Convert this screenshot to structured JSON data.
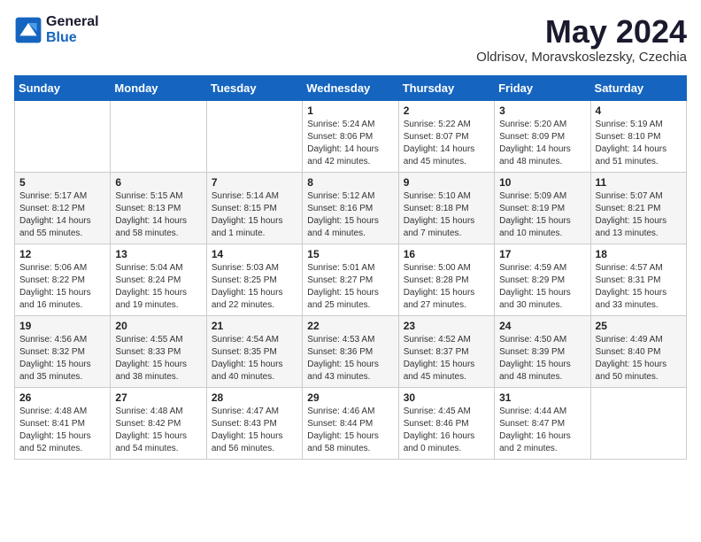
{
  "header": {
    "logo_general": "General",
    "logo_blue": "Blue",
    "month_year": "May 2024",
    "location": "Oldrisov, Moravskoslezsky, Czechia"
  },
  "weekdays": [
    "Sunday",
    "Monday",
    "Tuesday",
    "Wednesday",
    "Thursday",
    "Friday",
    "Saturday"
  ],
  "weeks": [
    [
      {
        "day": "",
        "sunrise": "",
        "sunset": "",
        "daylight": ""
      },
      {
        "day": "",
        "sunrise": "",
        "sunset": "",
        "daylight": ""
      },
      {
        "day": "",
        "sunrise": "",
        "sunset": "",
        "daylight": ""
      },
      {
        "day": "1",
        "sunrise": "Sunrise: 5:24 AM",
        "sunset": "Sunset: 8:06 PM",
        "daylight": "Daylight: 14 hours and 42 minutes."
      },
      {
        "day": "2",
        "sunrise": "Sunrise: 5:22 AM",
        "sunset": "Sunset: 8:07 PM",
        "daylight": "Daylight: 14 hours and 45 minutes."
      },
      {
        "day": "3",
        "sunrise": "Sunrise: 5:20 AM",
        "sunset": "Sunset: 8:09 PM",
        "daylight": "Daylight: 14 hours and 48 minutes."
      },
      {
        "day": "4",
        "sunrise": "Sunrise: 5:19 AM",
        "sunset": "Sunset: 8:10 PM",
        "daylight": "Daylight: 14 hours and 51 minutes."
      }
    ],
    [
      {
        "day": "5",
        "sunrise": "Sunrise: 5:17 AM",
        "sunset": "Sunset: 8:12 PM",
        "daylight": "Daylight: 14 hours and 55 minutes."
      },
      {
        "day": "6",
        "sunrise": "Sunrise: 5:15 AM",
        "sunset": "Sunset: 8:13 PM",
        "daylight": "Daylight: 14 hours and 58 minutes."
      },
      {
        "day": "7",
        "sunrise": "Sunrise: 5:14 AM",
        "sunset": "Sunset: 8:15 PM",
        "daylight": "Daylight: 15 hours and 1 minute."
      },
      {
        "day": "8",
        "sunrise": "Sunrise: 5:12 AM",
        "sunset": "Sunset: 8:16 PM",
        "daylight": "Daylight: 15 hours and 4 minutes."
      },
      {
        "day": "9",
        "sunrise": "Sunrise: 5:10 AM",
        "sunset": "Sunset: 8:18 PM",
        "daylight": "Daylight: 15 hours and 7 minutes."
      },
      {
        "day": "10",
        "sunrise": "Sunrise: 5:09 AM",
        "sunset": "Sunset: 8:19 PM",
        "daylight": "Daylight: 15 hours and 10 minutes."
      },
      {
        "day": "11",
        "sunrise": "Sunrise: 5:07 AM",
        "sunset": "Sunset: 8:21 PM",
        "daylight": "Daylight: 15 hours and 13 minutes."
      }
    ],
    [
      {
        "day": "12",
        "sunrise": "Sunrise: 5:06 AM",
        "sunset": "Sunset: 8:22 PM",
        "daylight": "Daylight: 15 hours and 16 minutes."
      },
      {
        "day": "13",
        "sunrise": "Sunrise: 5:04 AM",
        "sunset": "Sunset: 8:24 PM",
        "daylight": "Daylight: 15 hours and 19 minutes."
      },
      {
        "day": "14",
        "sunrise": "Sunrise: 5:03 AM",
        "sunset": "Sunset: 8:25 PM",
        "daylight": "Daylight: 15 hours and 22 minutes."
      },
      {
        "day": "15",
        "sunrise": "Sunrise: 5:01 AM",
        "sunset": "Sunset: 8:27 PM",
        "daylight": "Daylight: 15 hours and 25 minutes."
      },
      {
        "day": "16",
        "sunrise": "Sunrise: 5:00 AM",
        "sunset": "Sunset: 8:28 PM",
        "daylight": "Daylight: 15 hours and 27 minutes."
      },
      {
        "day": "17",
        "sunrise": "Sunrise: 4:59 AM",
        "sunset": "Sunset: 8:29 PM",
        "daylight": "Daylight: 15 hours and 30 minutes."
      },
      {
        "day": "18",
        "sunrise": "Sunrise: 4:57 AM",
        "sunset": "Sunset: 8:31 PM",
        "daylight": "Daylight: 15 hours and 33 minutes."
      }
    ],
    [
      {
        "day": "19",
        "sunrise": "Sunrise: 4:56 AM",
        "sunset": "Sunset: 8:32 PM",
        "daylight": "Daylight: 15 hours and 35 minutes."
      },
      {
        "day": "20",
        "sunrise": "Sunrise: 4:55 AM",
        "sunset": "Sunset: 8:33 PM",
        "daylight": "Daylight: 15 hours and 38 minutes."
      },
      {
        "day": "21",
        "sunrise": "Sunrise: 4:54 AM",
        "sunset": "Sunset: 8:35 PM",
        "daylight": "Daylight: 15 hours and 40 minutes."
      },
      {
        "day": "22",
        "sunrise": "Sunrise: 4:53 AM",
        "sunset": "Sunset: 8:36 PM",
        "daylight": "Daylight: 15 hours and 43 minutes."
      },
      {
        "day": "23",
        "sunrise": "Sunrise: 4:52 AM",
        "sunset": "Sunset: 8:37 PM",
        "daylight": "Daylight: 15 hours and 45 minutes."
      },
      {
        "day": "24",
        "sunrise": "Sunrise: 4:50 AM",
        "sunset": "Sunset: 8:39 PM",
        "daylight": "Daylight: 15 hours and 48 minutes."
      },
      {
        "day": "25",
        "sunrise": "Sunrise: 4:49 AM",
        "sunset": "Sunset: 8:40 PM",
        "daylight": "Daylight: 15 hours and 50 minutes."
      }
    ],
    [
      {
        "day": "26",
        "sunrise": "Sunrise: 4:48 AM",
        "sunset": "Sunset: 8:41 PM",
        "daylight": "Daylight: 15 hours and 52 minutes."
      },
      {
        "day": "27",
        "sunrise": "Sunrise: 4:48 AM",
        "sunset": "Sunset: 8:42 PM",
        "daylight": "Daylight: 15 hours and 54 minutes."
      },
      {
        "day": "28",
        "sunrise": "Sunrise: 4:47 AM",
        "sunset": "Sunset: 8:43 PM",
        "daylight": "Daylight: 15 hours and 56 minutes."
      },
      {
        "day": "29",
        "sunrise": "Sunrise: 4:46 AM",
        "sunset": "Sunset: 8:44 PM",
        "daylight": "Daylight: 15 hours and 58 minutes."
      },
      {
        "day": "30",
        "sunrise": "Sunrise: 4:45 AM",
        "sunset": "Sunset: 8:46 PM",
        "daylight": "Daylight: 16 hours and 0 minutes."
      },
      {
        "day": "31",
        "sunrise": "Sunrise: 4:44 AM",
        "sunset": "Sunset: 8:47 PM",
        "daylight": "Daylight: 16 hours and 2 minutes."
      },
      {
        "day": "",
        "sunrise": "",
        "sunset": "",
        "daylight": ""
      }
    ]
  ]
}
